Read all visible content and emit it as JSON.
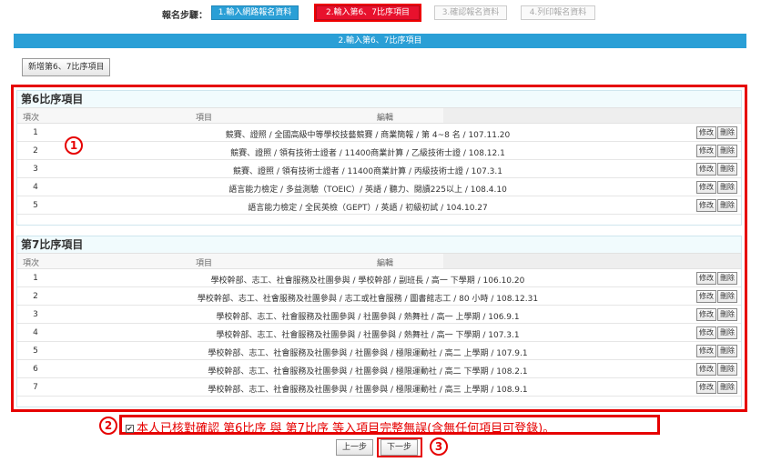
{
  "steps": {
    "label": "報名步驟：",
    "items": [
      {
        "label": "1.輸入網路報名資料"
      },
      {
        "label": "2.輸入第6、7比序項目"
      },
      {
        "label": "3.確認報名資料"
      },
      {
        "label": "4.列印報名資料"
      }
    ]
  },
  "title_bar": "2.輸入第6、7比序項目",
  "add_button": "新增第6、7比序項目",
  "columns": {
    "index": "項次",
    "item": "項目",
    "edit": "編輯"
  },
  "row_actions": {
    "modify": "修改",
    "delete": "刪除"
  },
  "group6": {
    "header": "第6比序項目",
    "rows": [
      {
        "index": "1",
        "text": "競賽、證照 / 全國高級中等學校技藝競賽 / 商業簡報 / 第 4~8 名 / 107.11.20"
      },
      {
        "index": "2",
        "text": "競賽、證照 / 領有技術士證者 / 11400商業計算 / 乙級技術士證 / 108.12.1"
      },
      {
        "index": "3",
        "text": "競賽、證照 / 領有技術士證者 / 11400商業計算 / 丙級技術士證 / 107.3.1"
      },
      {
        "index": "4",
        "text": "語言能力檢定 / 多益測驗（TOEIC）/ 英語 / 聽力、閱讀225以上 / 108.4.10"
      },
      {
        "index": "5",
        "text": "語言能力檢定 / 全民英檢（GEPT）/ 英語 / 初級初試 / 104.10.27"
      }
    ]
  },
  "group7": {
    "header": "第7比序項目",
    "rows": [
      {
        "index": "1",
        "text": "學校幹部、志工、社會服務及社團參與 / 學校幹部 / 副班長 / 高一 下學期 / 106.10.20"
      },
      {
        "index": "2",
        "text": "學校幹部、志工、社會服務及社團參與 / 志工或社會服務 / 圖書館志工 / 80 小時 / 108.12.31"
      },
      {
        "index": "3",
        "text": "學校幹部、志工、社會服務及社團參與 / 社團參與 / 熱舞社 / 高一 上學期 / 106.9.1"
      },
      {
        "index": "4",
        "text": "學校幹部、志工、社會服務及社團參與 / 社團參與 / 熱舞社 / 高一 下學期 / 107.3.1"
      },
      {
        "index": "5",
        "text": "學校幹部、志工、社會服務及社團參與 / 社團參與 / 極限運動社 / 高二 上學期 / 107.9.1"
      },
      {
        "index": "6",
        "text": "學校幹部、志工、社會服務及社團參與 / 社團參與 / 極限運動社 / 高二 下學期 / 108.2.1"
      },
      {
        "index": "7",
        "text": "學校幹部、志工、社會服務及社團參與 / 社團參與 / 極限運動社 / 高三 上學期 / 108.9.1"
      }
    ]
  },
  "annotations": {
    "one": "1",
    "two": "2",
    "three": "3"
  },
  "confirm": {
    "check_mark": "✔",
    "text": "本人已核對確認 第6比序 與 第7比序 等入項目完整無誤(含無任何項目可登錄)。"
  },
  "nav": {
    "prev": "上一步",
    "next": "下一步"
  }
}
